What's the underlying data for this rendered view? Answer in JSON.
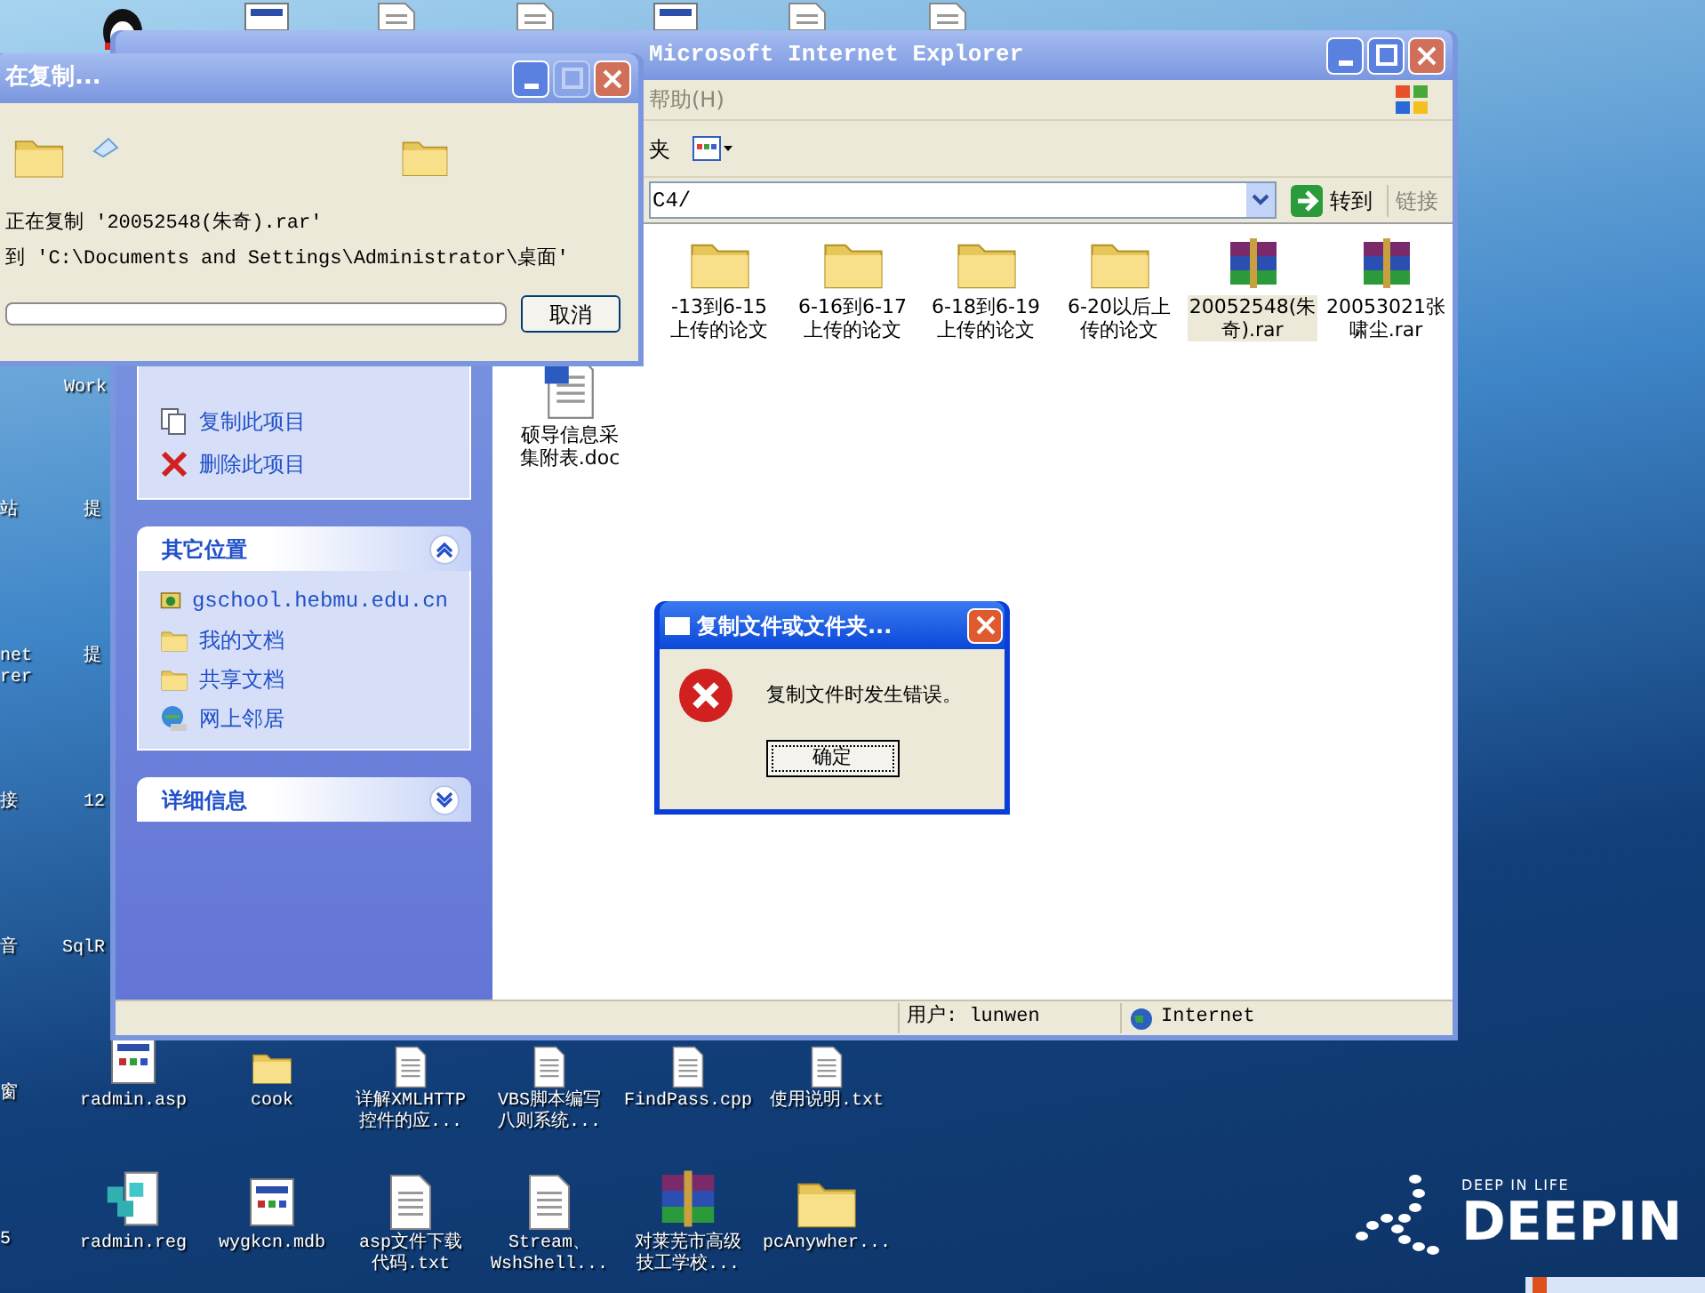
{
  "desktop": {
    "edge_labels": [
      {
        "lines": [
          "Work"
        ]
      },
      {
        "lines": [
          "站"
        ]
      },
      {
        "lines": [
          "提"
        ]
      },
      {
        "lines": [
          "net",
          "rer"
        ]
      },
      {
        "lines": [
          "提"
        ]
      },
      {
        "lines": [
          "接"
        ]
      },
      {
        "lines": [
          "12"
        ]
      },
      {
        "lines": [
          "音"
        ]
      },
      {
        "lines": [
          "SqlR"
        ]
      },
      {
        "lines": [
          "窗"
        ]
      },
      {
        "lines": [
          "5"
        ]
      }
    ],
    "icons": [
      {
        "kind": "app",
        "lines": [
          "radmin.asp"
        ]
      },
      {
        "kind": "folder",
        "lines": [
          "cook"
        ]
      },
      {
        "kind": "text",
        "lines": [
          "详解XMLHTTP",
          "控件的应..."
        ]
      },
      {
        "kind": "text",
        "lines": [
          "VBS脚本编写",
          "八则系统..."
        ]
      },
      {
        "kind": "text",
        "lines": [
          "FindPass.cpp"
        ]
      },
      {
        "kind": "text",
        "lines": [
          "使用说明.txt"
        ]
      },
      {
        "kind": "registry",
        "lines": [
          "radmin.reg"
        ]
      },
      {
        "kind": "app",
        "lines": [
          "wygkcn.mdb"
        ]
      },
      {
        "kind": "text",
        "lines": [
          "asp文件下载",
          "代码.txt"
        ]
      },
      {
        "kind": "text",
        "lines": [
          "Stream、",
          "WshShell..."
        ]
      },
      {
        "kind": "archive",
        "lines": [
          "对莱芜市高级",
          "技工学校..."
        ]
      },
      {
        "kind": "folder",
        "lines": [
          "pcAnywher..."
        ]
      }
    ],
    "logo": {
      "tagline": "DEEP IN LIFE",
      "name": "DEEPIN"
    }
  },
  "explorer": {
    "title": "Microsoft Internet Explorer",
    "menu": [
      "帮助(H)"
    ],
    "toolbar_label": "夹",
    "address": "C4/",
    "go_button": "转到",
    "links": "链接",
    "task_items": [
      {
        "kind": "copy",
        "label": "复制此项目"
      },
      {
        "kind": "delete",
        "label": "删除此项目"
      }
    ],
    "other_places": {
      "title": "其它位置",
      "expanded": true,
      "items": [
        {
          "kind": "web-folder",
          "label": "gschool.hebmu.edu.cn"
        },
        {
          "kind": "documents",
          "label": "我的文档"
        },
        {
          "kind": "folder",
          "label": "共享文档"
        },
        {
          "kind": "network",
          "label": "网上邻居"
        }
      ]
    },
    "details": {
      "title": "详细信息",
      "expanded": false
    },
    "file_rows": [
      [
        {
          "kind": "folder",
          "lines": [
            "-13到6-15",
            "上传的论文"
          ],
          "selected": false
        },
        {
          "kind": "folder",
          "lines": [
            "6-16到6-17",
            "上传的论文"
          ],
          "selected": false
        },
        {
          "kind": "folder",
          "lines": [
            "6-18到6-19",
            "上传的论文"
          ],
          "selected": false
        },
        {
          "kind": "folder",
          "lines": [
            "6-20以后上",
            "传的论文"
          ],
          "selected": false
        },
        {
          "kind": "archive",
          "lines": [
            "20052548(朱",
            "奇).rar"
          ],
          "selected": true
        },
        {
          "kind": "archive",
          "lines": [
            "20053021张",
            "啸尘.rar"
          ],
          "selected": false
        }
      ],
      [
        {
          "kind": "word",
          "lines": [
            "硕导信息采",
            "集附表.doc"
          ],
          "selected": false
        }
      ]
    ],
    "status": {
      "user": "用户: lunwen",
      "zone": "Internet"
    }
  },
  "copy_dialog": {
    "title": "在复制...",
    "line_1": "正在复制 '20052548(朱奇).rar'",
    "line_2": "到 'C:\\Documents and Settings\\Administrator\\桌面'",
    "progress": {
      "level": 0
    },
    "cancel": "取消"
  },
  "error_dialog": {
    "title": "复制文件或文件夹...",
    "message": "复制文件时发生错误。",
    "ok": "确定"
  }
}
